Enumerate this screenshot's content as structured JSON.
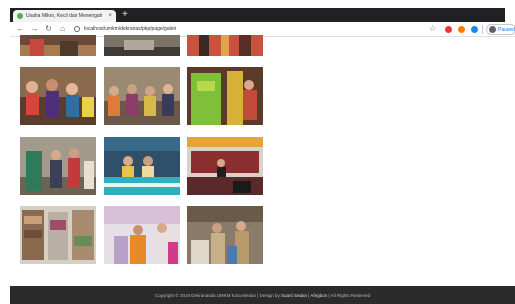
{
  "browser": {
    "tab_title": "Usaha Mikro, Kecil dan Menengah",
    "tab_close": "×",
    "new_tab": "+",
    "url": "localhost/umkm/dekranas/pkp/page/galeri",
    "profile_label": "Paused"
  },
  "gallery": {
    "photos": [
      {
        "label": "galeri-foto-1"
      },
      {
        "label": "galeri-foto-2"
      },
      {
        "label": "galeri-foto-3"
      },
      {
        "label": "galeri-foto-4"
      },
      {
        "label": "galeri-foto-5"
      },
      {
        "label": "galeri-foto-6"
      },
      {
        "label": "galeri-foto-7"
      },
      {
        "label": "galeri-foto-8"
      },
      {
        "label": "galeri-foto-9"
      },
      {
        "label": "galeri-foto-10"
      },
      {
        "label": "galeri-foto-11"
      },
      {
        "label": "galeri-foto-12"
      }
    ]
  },
  "footer": {
    "copyright": "Copyright © 2019 Dekranasda UMKM Kota Medan",
    "design_by": " | Design by ",
    "designer": "Suarti Sedan",
    "and": " | ",
    "developer": "Afegbon",
    "rights": " | All Rights Reserved"
  },
  "icons": {
    "back": "back-arrow-icon",
    "forward": "forward-arrow-icon",
    "reload": "reload-icon",
    "home": "home-icon",
    "info": "info-icon",
    "star": "star-icon"
  },
  "colors": {
    "tabstrip": "#202124",
    "footer_bg": "#2b2b2b",
    "accent": "#1a73e8"
  }
}
